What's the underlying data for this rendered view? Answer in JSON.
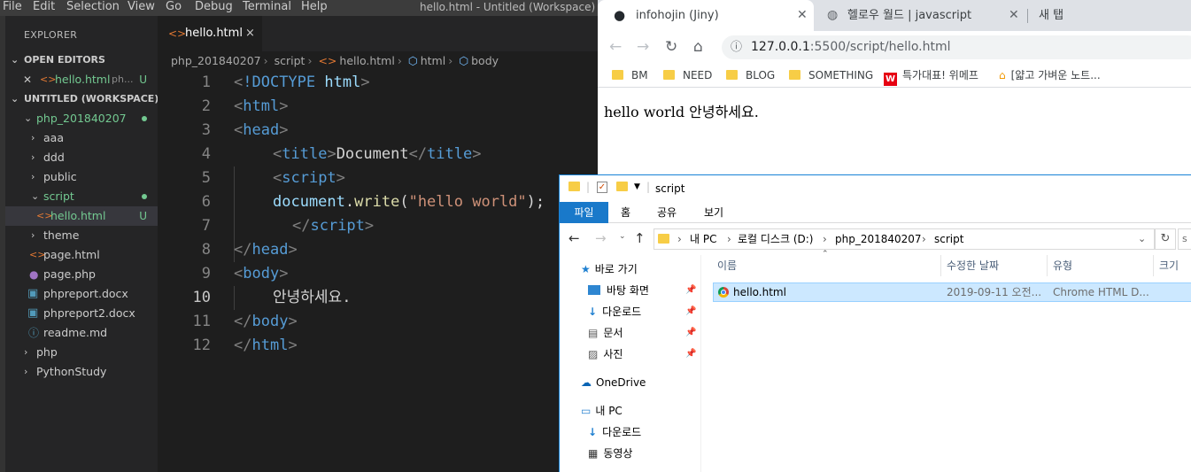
{
  "vscode": {
    "menu": [
      "File",
      "Edit",
      "Selection",
      "View",
      "Go",
      "Debug",
      "Terminal",
      "Help"
    ],
    "window_title": "hello.html - Untitled (Workspace) - Vis",
    "explorer_title": "EXPLORER",
    "open_editors": {
      "title": "OPEN EDITORS",
      "item_name": "hello.html",
      "item_dir": "ph...",
      "item_badge": "U"
    },
    "workspace": {
      "title": "UNTITLED (WORKSPACE)",
      "items": [
        {
          "label": "php_201840207"
        },
        {
          "label": "aaa"
        },
        {
          "label": "ddd"
        },
        {
          "label": "public"
        },
        {
          "label": "script"
        },
        {
          "label": "hello.html",
          "badge": "U"
        },
        {
          "label": "theme"
        },
        {
          "label": "page.html"
        },
        {
          "label": "page.php"
        },
        {
          "label": "phpreport.docx"
        },
        {
          "label": "phpreport2.docx"
        },
        {
          "label": "readme.md"
        },
        {
          "label": "php"
        },
        {
          "label": "PythonStudy"
        }
      ]
    },
    "tab": {
      "label": "hello.html",
      "close": "×"
    },
    "breadcrumb": [
      "php_201840207",
      "script",
      "hello.html",
      "html",
      "body"
    ],
    "code": {
      "line_numbers": [
        "1",
        "2",
        "3",
        "4",
        "5",
        "6",
        "7",
        "8",
        "9",
        "10",
        "11",
        "12"
      ],
      "doctype_kw": "!DOCTYPE",
      "doctype_val": "html",
      "html": "html",
      "head": "head",
      "title": "title",
      "title_text": "Document",
      "script": "script",
      "js_obj": "document",
      "js_fn": "write",
      "js_str": "\"hello world\"",
      "js_tail": ");",
      "body": "body",
      "body_text": "안녕하세요."
    }
  },
  "chrome": {
    "tabs": [
      {
        "title": "infohojin (Jiny)"
      },
      {
        "title": "헬로우 월드 | javascript"
      },
      {
        "title": "새 탭"
      }
    ],
    "url_host": "127.0.0.1",
    "url_rest": ":5500/script/hello.html",
    "bookmarks": [
      "BM",
      "NEED",
      "BLOG",
      "SOMETHING",
      "특가대표! 위메프",
      "[얇고 가벼운 노트..."
    ],
    "page_text": "hello world 안녕하세요."
  },
  "explorer": {
    "qat_title": "script",
    "ribbon_tabs": [
      "파일",
      "홈",
      "공유",
      "보기"
    ],
    "address": [
      "내 PC",
      "로컬 디스크 (D:)",
      "php_201840207",
      "script"
    ],
    "search_placeholder": "s",
    "nav": {
      "quick_access": "바로 가기",
      "desktop": "바탕 화면",
      "downloads": "다운로드",
      "documents": "문서",
      "pictures": "사진",
      "onedrive": "OneDrive",
      "this_pc": "내 PC",
      "pc_downloads": "다운로드",
      "videos": "동영상"
    },
    "columns": [
      "이름",
      "수정한 날짜",
      "유형",
      "크기"
    ],
    "file": {
      "name": "hello.html",
      "modified": "2019-09-11 오전...",
      "type": "Chrome HTML D..."
    }
  }
}
